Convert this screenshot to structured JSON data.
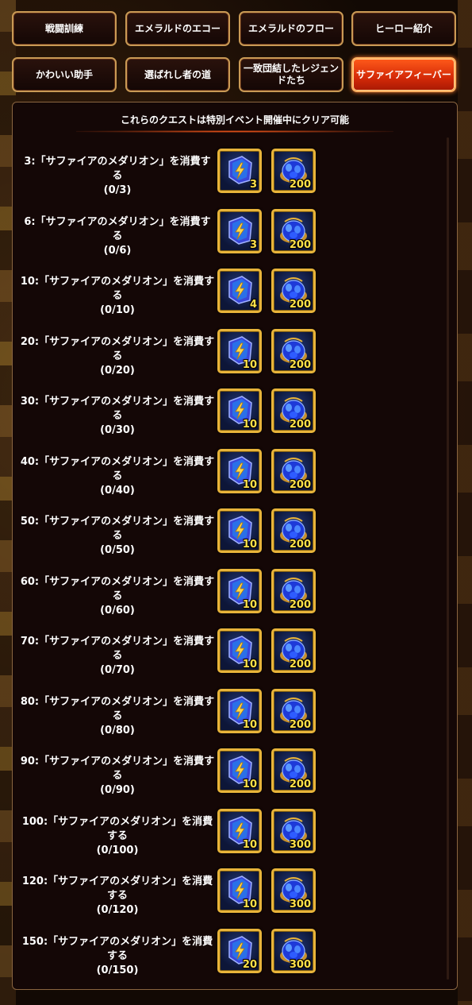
{
  "tabs": [
    {
      "label": "戦闘訓練",
      "active": false
    },
    {
      "label": "エメラルドのエコー",
      "active": false
    },
    {
      "label": "エメラルドのフロー",
      "active": false
    },
    {
      "label": "ヒーロー紹介",
      "active": false
    },
    {
      "label": "かわいい助手",
      "active": false
    },
    {
      "label": "選ばれし者の道",
      "active": false
    },
    {
      "label": "一致団結したレジェンドたち",
      "active": false
    },
    {
      "label": "サファイアフィーバー",
      "active": true
    }
  ],
  "panel": {
    "header": "これらのクエストは特別イベント開催中にクリア可能"
  },
  "quests": [
    {
      "title": "3:「サファイアのメダリオン」を消費する",
      "progress": "(0/3)",
      "rewards": [
        {
          "icon": "sapphire-medallion-icon",
          "count": "3"
        },
        {
          "icon": "sapphire-gem-pile-icon",
          "count": "200"
        }
      ]
    },
    {
      "title": "6:「サファイアのメダリオン」を消費する",
      "progress": "(0/6)",
      "rewards": [
        {
          "icon": "sapphire-medallion-icon",
          "count": "3"
        },
        {
          "icon": "sapphire-gem-pile-icon",
          "count": "200"
        }
      ]
    },
    {
      "title": "10:「サファイアのメダリオン」を消費する",
      "progress": "(0/10)",
      "rewards": [
        {
          "icon": "sapphire-medallion-icon",
          "count": "4"
        },
        {
          "icon": "sapphire-gem-pile-icon",
          "count": "200"
        }
      ]
    },
    {
      "title": "20:「サファイアのメダリオン」を消費する",
      "progress": "(0/20)",
      "rewards": [
        {
          "icon": "sapphire-medallion-icon",
          "count": "10"
        },
        {
          "icon": "sapphire-gem-pile-icon",
          "count": "200"
        }
      ]
    },
    {
      "title": "30:「サファイアのメダリオン」を消費する",
      "progress": "(0/30)",
      "rewards": [
        {
          "icon": "sapphire-medallion-icon",
          "count": "10"
        },
        {
          "icon": "sapphire-gem-pile-icon",
          "count": "200"
        }
      ]
    },
    {
      "title": "40:「サファイアのメダリオン」を消費する",
      "progress": "(0/40)",
      "rewards": [
        {
          "icon": "sapphire-medallion-icon",
          "count": "10"
        },
        {
          "icon": "sapphire-gem-pile-icon",
          "count": "200"
        }
      ]
    },
    {
      "title": "50:「サファイアのメダリオン」を消費する",
      "progress": "(0/50)",
      "rewards": [
        {
          "icon": "sapphire-medallion-icon",
          "count": "10"
        },
        {
          "icon": "sapphire-gem-pile-icon",
          "count": "200"
        }
      ]
    },
    {
      "title": "60:「サファイアのメダリオン」を消費する",
      "progress": "(0/60)",
      "rewards": [
        {
          "icon": "sapphire-medallion-icon",
          "count": "10"
        },
        {
          "icon": "sapphire-gem-pile-icon",
          "count": "200"
        }
      ]
    },
    {
      "title": "70:「サファイアのメダリオン」を消費する",
      "progress": "(0/70)",
      "rewards": [
        {
          "icon": "sapphire-medallion-icon",
          "count": "10"
        },
        {
          "icon": "sapphire-gem-pile-icon",
          "count": "200"
        }
      ]
    },
    {
      "title": "80:「サファイアのメダリオン」を消費する",
      "progress": "(0/80)",
      "rewards": [
        {
          "icon": "sapphire-medallion-icon",
          "count": "10"
        },
        {
          "icon": "sapphire-gem-pile-icon",
          "count": "200"
        }
      ]
    },
    {
      "title": "90:「サファイアのメダリオン」を消費する",
      "progress": "(0/90)",
      "rewards": [
        {
          "icon": "sapphire-medallion-icon",
          "count": "10"
        },
        {
          "icon": "sapphire-gem-pile-icon",
          "count": "200"
        }
      ]
    },
    {
      "title": "100:「サファイアのメダリオン」を消費する",
      "progress": "(0/100)",
      "rewards": [
        {
          "icon": "sapphire-medallion-icon",
          "count": "10"
        },
        {
          "icon": "sapphire-gem-pile-icon",
          "count": "300"
        }
      ]
    },
    {
      "title": "120:「サファイアのメダリオン」を消費する",
      "progress": "(0/120)",
      "rewards": [
        {
          "icon": "sapphire-medallion-icon",
          "count": "10"
        },
        {
          "icon": "sapphire-gem-pile-icon",
          "count": "300"
        }
      ]
    },
    {
      "title": "150:「サファイアのメダリオン」を消費する",
      "progress": "(0/150)",
      "rewards": [
        {
          "icon": "sapphire-medallion-icon",
          "count": "20"
        },
        {
          "icon": "sapphire-gem-pile-icon",
          "count": "300"
        }
      ]
    }
  ],
  "colors": {
    "tab_border": "#c99a55",
    "tab_active": "#e0320c",
    "reward_frame": "#e8b43a",
    "count_text": "#ffe14a"
  }
}
